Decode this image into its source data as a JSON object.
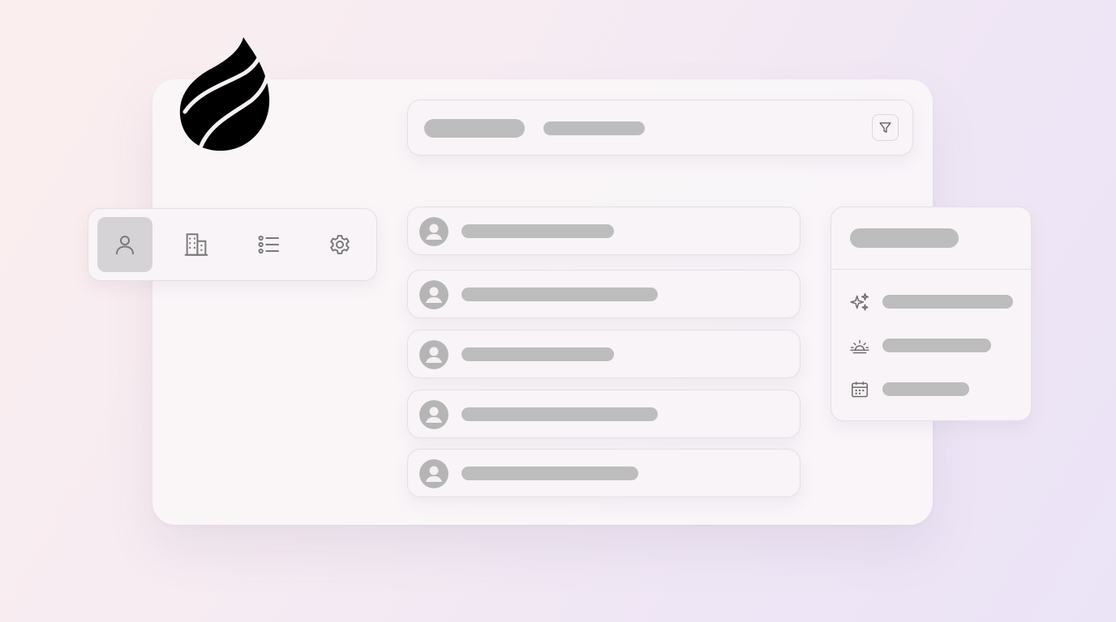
{
  "brand": {
    "logo_icon": "flame-leaf-logo",
    "color": "#000000"
  },
  "colors": {
    "placeholder": "#bdbdbd",
    "icon": "#7a7a7a",
    "active_nav_bg": "#d6d3d6"
  },
  "header": {
    "filter_icon": "filter-icon"
  },
  "nav": {
    "items": [
      {
        "icon": "user-icon",
        "active": true
      },
      {
        "icon": "building-icon",
        "active": false
      },
      {
        "icon": "list-icon",
        "active": false
      },
      {
        "icon": "gear-icon",
        "active": false
      }
    ]
  },
  "list": {
    "rows": [
      {
        "icon": "avatar-icon"
      },
      {
        "icon": "avatar-icon"
      },
      {
        "icon": "avatar-icon"
      },
      {
        "icon": "avatar-icon"
      },
      {
        "icon": "avatar-icon"
      }
    ]
  },
  "menu": {
    "items": [
      {
        "icon": "sparkles-icon"
      },
      {
        "icon": "sunrise-icon"
      },
      {
        "icon": "calendar-icon"
      }
    ]
  }
}
